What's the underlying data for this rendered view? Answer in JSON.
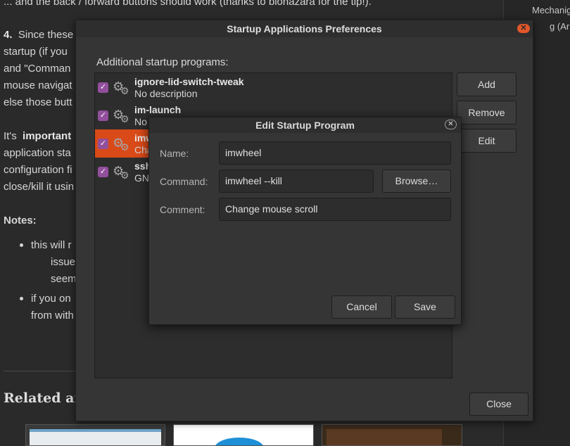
{
  "article": {
    "line0": "... and the back / forward buttons should work (thanks to biohazara for the tip!).",
    "p4_num": "4.",
    "p4_line1": "Since  these",
    "p4_line2": "startup  (if you",
    "p4_line3": "and \"Comman",
    "p4_line4": "mouse navigat",
    "p4_line5": "else those butt",
    "imp_pre": "It's",
    "imp_bold": "important",
    "imp_line2": "application sta",
    "imp_line3": "configuration fi",
    "imp_line4": "close/kill it usin",
    "notes": "Notes:",
    "b1_line1": "this  will  r",
    "b1_line2": "issue, yo",
    "b1_line3": "seems to",
    "b2_line1": "if you  on",
    "b2_line2": "from with",
    "related": "Related arti"
  },
  "sidebar": {
    "line1": "Mechanig",
    "line2": "g (Ar"
  },
  "window": {
    "title": "Startup Applications Preferences",
    "section_label": "Additional startup programs:",
    "buttons": {
      "add": "Add",
      "remove": "Remove",
      "edit": "Edit",
      "close": "Close"
    },
    "items": [
      {
        "name": "ignore-lid-switch-tweak",
        "desc": "No description",
        "checked": true,
        "selected": false
      },
      {
        "name": "im-launch",
        "desc": "No",
        "checked": true,
        "selected": false
      },
      {
        "name": "imw",
        "desc": "Cha",
        "checked": true,
        "selected": true
      },
      {
        "name": "ssh",
        "desc": "GN",
        "checked": true,
        "selected": false
      }
    ]
  },
  "dialog": {
    "title": "Edit Startup Program",
    "name_label": "Name:",
    "name_value": "imwheel",
    "command_label": "Command:",
    "command_value": "imwheel --kill",
    "browse_label": "Browse…",
    "comment_label": "Comment:",
    "comment_value": "Change mouse scroll",
    "cancel_label": "Cancel",
    "save_label": "Save"
  },
  "icons": {
    "check": "checkmark-icon",
    "gear": "gears-icon",
    "close": "close-icon"
  },
  "colors": {
    "accent": "#d94a18",
    "checkbox": "#924f9c",
    "window_bg": "#353535",
    "close_button": "#e2572a"
  }
}
